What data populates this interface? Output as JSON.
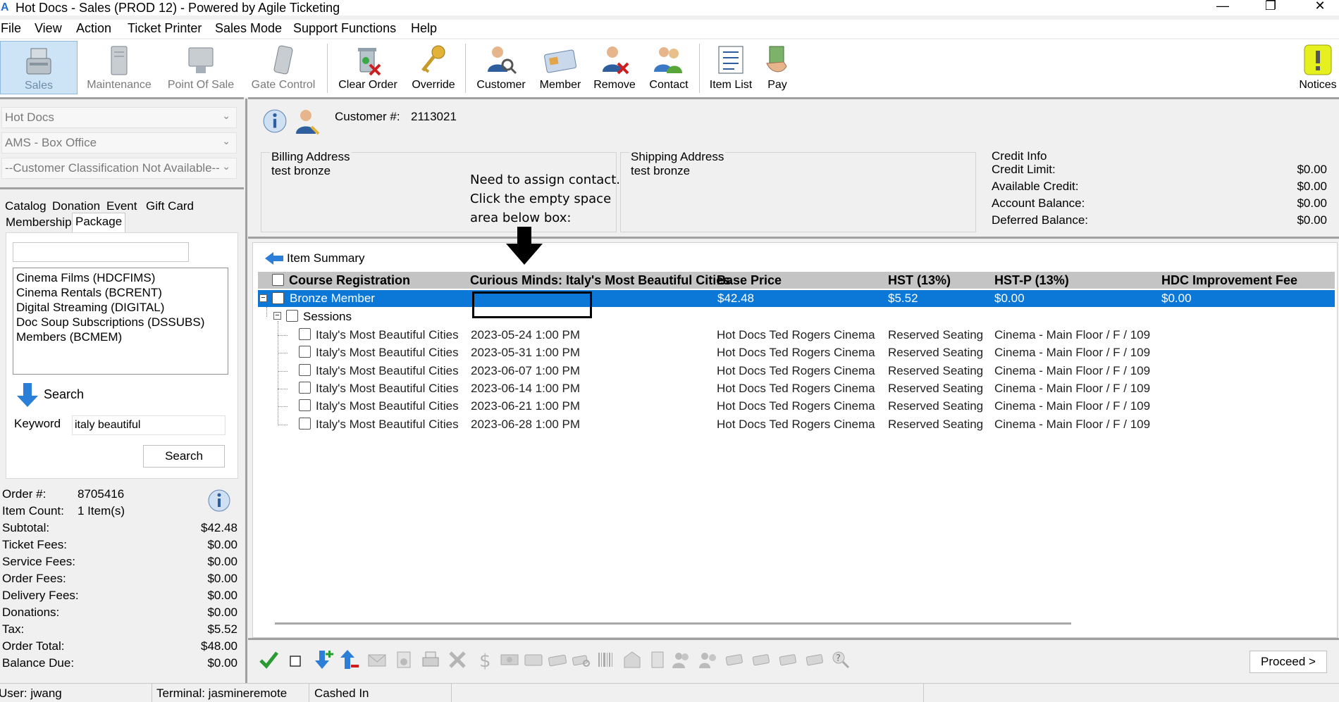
{
  "window": {
    "title": "Hot Docs - Sales (PROD 12) - Powered by Agile Ticketing",
    "app_icon_glyph": "A",
    "minimize": "—",
    "maximize": "❐",
    "close": "✕"
  },
  "menu": [
    "File",
    "View",
    "Action",
    "Ticket Printer",
    "Sales Mode",
    "Support Functions",
    "Help"
  ],
  "toolbar": {
    "sales": "Sales",
    "maintenance": "Maintenance",
    "point_of_sale": "Point Of Sale",
    "gate_control": "Gate Control",
    "clear_order": "Clear Order",
    "override": "Override",
    "customer": "Customer",
    "member": "Member",
    "remove": "Remove",
    "contact": "Contact",
    "item_list": "Item List",
    "pay": "Pay",
    "notices": "Notices"
  },
  "left": {
    "organization": "Hot Docs",
    "venue": "AMS - Box Office",
    "classification": "--Customer Classification Not Available--",
    "tabs": {
      "catalog": "Catalog",
      "donation": "Donation",
      "event": "Event",
      "gift_card": "Gift Card",
      "membership": "Membership",
      "package": "Package"
    },
    "filter_value": "",
    "packages": [
      "Cinema Films  (HDCFIMS)",
      "Cinema Rentals  (BCRENT)",
      "Digital Streaming  (DIGITAL)",
      "Doc Soup Subscriptions  (DSSUBS)",
      "Members  (BCMEM)"
    ],
    "search_heading": "Search",
    "keyword_label": "Keyword",
    "keyword_value": "italy beautiful",
    "search_button": "Search"
  },
  "order": {
    "order_no_label": "Order #:",
    "order_no": "8705416",
    "item_count_label": "Item Count:",
    "item_count": "1 Item(s)",
    "subtotal_label": "Subtotal:",
    "subtotal": "$42.48",
    "ticket_fees_label": "Ticket Fees:",
    "ticket_fees": "$0.00",
    "service_fees_label": "Service Fees:",
    "service_fees": "$0.00",
    "order_fees_label": "Order Fees:",
    "order_fees": "$0.00",
    "delivery_fees_label": "Delivery Fees:",
    "delivery_fees": "$0.00",
    "donations_label": "Donations:",
    "donations": "$0.00",
    "tax_label": "Tax:",
    "tax": "$5.52",
    "order_total_label": "Order Total:",
    "order_total": "$48.00",
    "balance_due_label": "Balance Due:",
    "balance_due": "$0.00"
  },
  "customer": {
    "label": "Customer #:",
    "number": "2113021",
    "billing_heading": "Billing Address",
    "billing_name": "test bronze",
    "shipping_heading": "Shipping Address",
    "shipping_name": "test bronze",
    "credit_heading": "Credit Info",
    "credit_limit_label": "Credit Limit:",
    "credit_limit": "$0.00",
    "available_credit_label": "Available Credit:",
    "available_credit": "$0.00",
    "account_balance_label": "Account Balance:",
    "account_balance": "$0.00",
    "deferred_balance_label": "Deferred Balance:",
    "deferred_balance": "$0.00"
  },
  "annotation": {
    "line1": "Need to assign contact.",
    "line2": "Click the empty space",
    "line3": "area below box:"
  },
  "summary": {
    "title": "Item Summary",
    "columns": {
      "c1": "Course Registration",
      "c2": "Curious Minds: Italy's Most Beautiful Cities",
      "c3": "Base Price",
      "c4": "HST (13%)",
      "c5": "HST-P (13%)",
      "c6": "HDC Improvement Fee"
    },
    "selected_row": {
      "name": "Bronze Member",
      "contact": "",
      "base_price": "$42.48",
      "hst": "$5.52",
      "hst_p": "$0.00",
      "improvement_fee": "$0.00"
    },
    "sessions_label": "Sessions",
    "sessions": [
      {
        "name": "Italy's Most Beautiful Cities",
        "date": "2023-05-24 1:00 PM",
        "venue": "Hot Docs Ted Rogers Cinema",
        "seating": "Reserved Seating",
        "location": "Cinema - Main Floor / F / 109"
      },
      {
        "name": "Italy's Most Beautiful Cities",
        "date": "2023-05-31 1:00 PM",
        "venue": "Hot Docs Ted Rogers Cinema",
        "seating": "Reserved Seating",
        "location": "Cinema - Main Floor / F / 109"
      },
      {
        "name": "Italy's Most Beautiful Cities",
        "date": "2023-06-07 1:00 PM",
        "venue": "Hot Docs Ted Rogers Cinema",
        "seating": "Reserved Seating",
        "location": "Cinema - Main Floor / F / 109"
      },
      {
        "name": "Italy's Most Beautiful Cities",
        "date": "2023-06-14 1:00 PM",
        "venue": "Hot Docs Ted Rogers Cinema",
        "seating": "Reserved Seating",
        "location": "Cinema - Main Floor / F / 109"
      },
      {
        "name": "Italy's Most Beautiful Cities",
        "date": "2023-06-21 1:00 PM",
        "venue": "Hot Docs Ted Rogers Cinema",
        "seating": "Reserved Seating",
        "location": "Cinema - Main Floor / F / 109"
      },
      {
        "name": "Italy's Most Beautiful Cities",
        "date": "2023-06-28 1:00 PM",
        "venue": "Hot Docs Ted Rogers Cinema",
        "seating": "Reserved Seating",
        "location": "Cinema - Main Floor / F / 109"
      }
    ]
  },
  "actions": {
    "proceed": "Proceed >"
  },
  "status": {
    "user": "User:  jwang",
    "terminal": "Terminal: jasmineremote",
    "cash": "Cashed In"
  },
  "colors": {
    "selection": "#0b78d7",
    "header_bg": "#c4c4c4"
  }
}
